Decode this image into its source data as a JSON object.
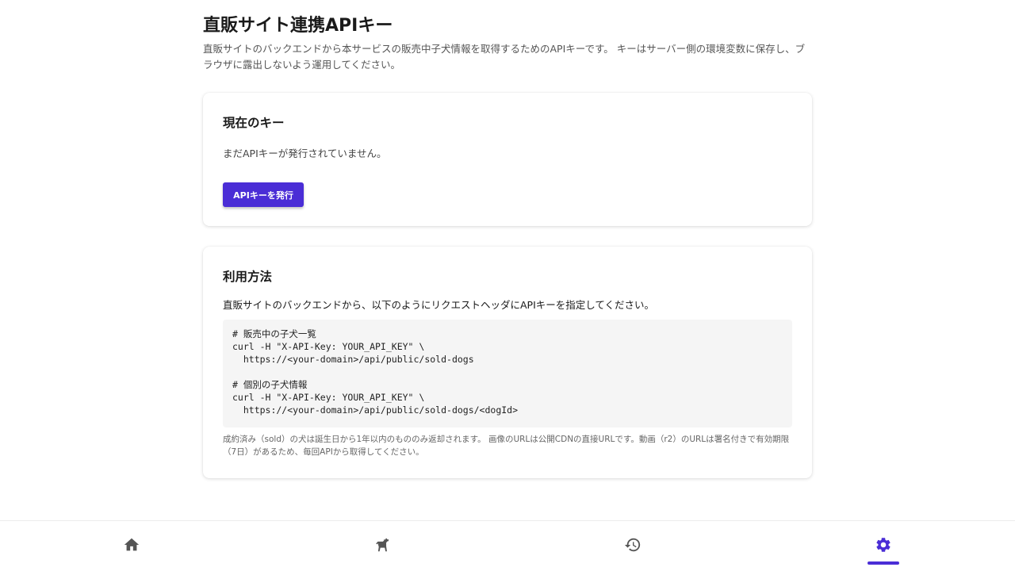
{
  "page": {
    "title": "直販サイト連携APIキー",
    "description": "直販サイトのバックエンドから本サービスの販売中子犬情報を取得するためのAPIキーです。 キーはサーバー側の環境変数に保存し、ブラウザに露出しないよう運用してください。"
  },
  "current_key": {
    "title": "現在のキー",
    "status": "まだAPIキーが発行されていません。",
    "issue_button": "APIキーを発行"
  },
  "usage": {
    "title": "利用方法",
    "intro": "直販サイトのバックエンドから、以下のようにリクエストヘッダにAPIキーを指定してください。",
    "code_section1": [
      "# 販売中の子犬一覧",
      "curl -H \"X-API-Key: YOUR_API_KEY\" \\",
      "  https://<your-domain>/api/public/sold-dogs"
    ],
    "code_section2": [
      "# 個別の子犬情報",
      "curl -H \"X-API-Key: YOUR_API_KEY\" \\",
      "  https://<your-domain>/api/public/sold-dogs/<dogId>"
    ],
    "note": "成約済み（sold）の犬は誕生日から1年以内のもののみ返却されます。 画像のURLは公開CDNの直接URLです。動画（r2）のURLは署名付きで有効期限（7日）があるため、毎回APIから取得してください。"
  },
  "nav": {
    "items": [
      {
        "icon": "home-icon",
        "active": false
      },
      {
        "icon": "dog-icon",
        "active": false
      },
      {
        "icon": "history-icon",
        "active": false
      },
      {
        "icon": "gear-icon",
        "active": true
      }
    ],
    "active_color": "#4a2dd6",
    "inactive_color": "#555555"
  },
  "colors": {
    "accent": "#4a2dd6"
  }
}
